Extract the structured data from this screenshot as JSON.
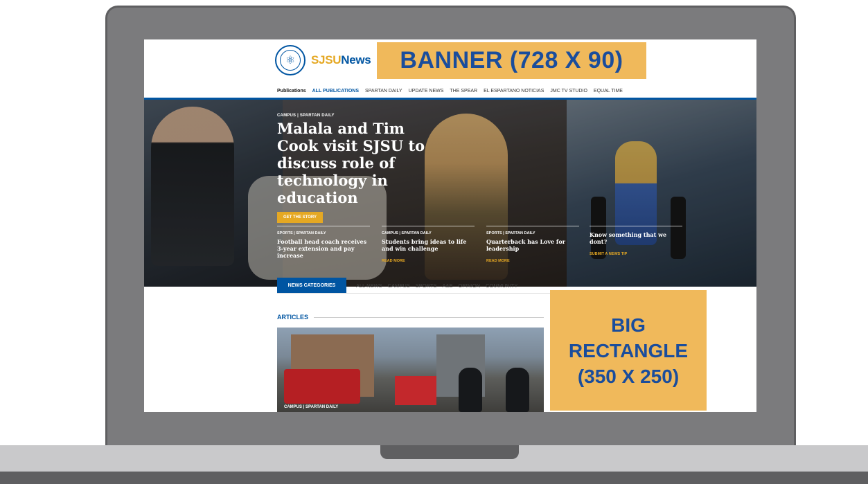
{
  "header": {
    "logo_main": "SJSU",
    "logo_accent": "News",
    "banner_ad_label": "BANNER (728 X 90)"
  },
  "publications_nav": {
    "lead": "Publications",
    "items": [
      "ALL PUBLICATIONS",
      "SPARTAN DAILY",
      "UPDATE NEWS",
      "THE SPEAR",
      "EL ESPARTANO NOTICIAS",
      "JMC TV STUDIO",
      "EQUAL TIME"
    ]
  },
  "hero": {
    "kicker": "CAMPUS | SPARTAN DAILY",
    "title": "Malala and Tim Cook visit SJSU to discuss role of technology in education",
    "cta": "GET THE STORY"
  },
  "stories": [
    {
      "kicker": "SPORTS | SPARTAN DAILY",
      "title": "Football head coach receives 3-year extension and pay increase",
      "link": ""
    },
    {
      "kicker": "CAMPUS | SPARTAN DAILY",
      "title": "Students bring ideas to life and win challenge",
      "link": "READ MORE"
    },
    {
      "kicker": "SPORTS | SPARTAN DAILY",
      "title": "Quarterback has Love for leadership",
      "link": "READ MORE"
    }
  ],
  "news_tip": {
    "title": "Know something that we dont?",
    "link": "SUBMIT A NEWS TIP"
  },
  "news_categories": {
    "label": "NEWS CATEGORIES",
    "items": [
      "ALL NEWS",
      "CAMPUS",
      "SPORTS",
      "A&E",
      "OPINION",
      "COMMUNITY"
    ]
  },
  "articles": {
    "heading": "ARTICLES",
    "first_article_kicker": "CAMPUS | SPARTAN DAILY"
  },
  "big_rect_ad": {
    "line1": "BIG",
    "line2": "RECTANGLE",
    "line3": "(350 X 250)"
  },
  "colors": {
    "sjsu_blue": "#0055a2",
    "sjsu_gold": "#e5a823",
    "ad_placeholder": "#f0b95b",
    "ad_text": "#1a4d9c"
  },
  "icons": {
    "logo_seal": "university-seal-icon"
  }
}
